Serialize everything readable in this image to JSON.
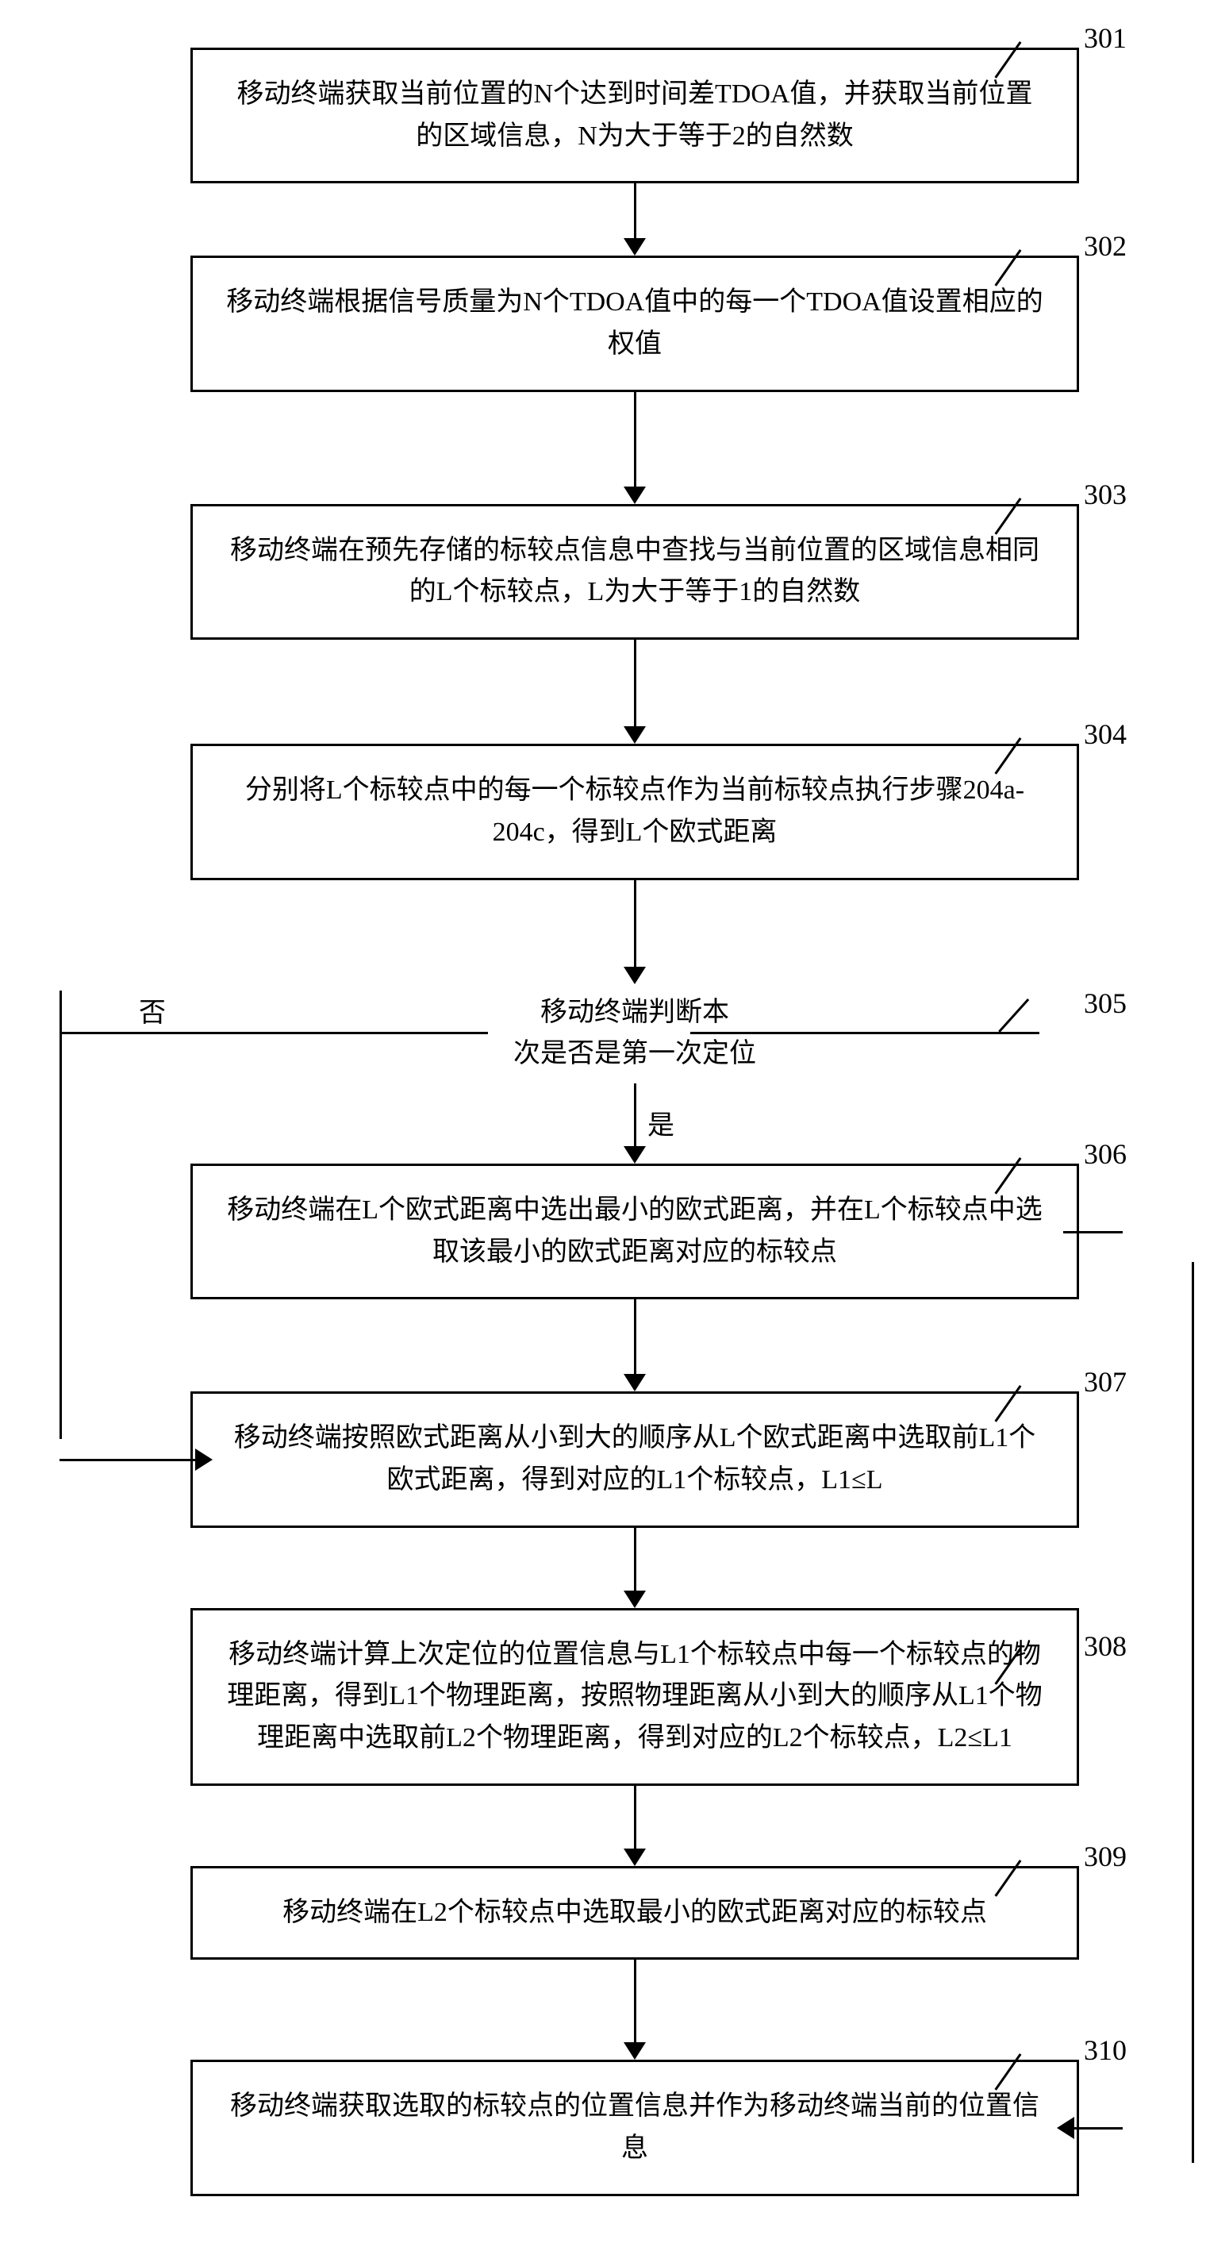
{
  "steps": {
    "s301": {
      "num": "301",
      "text": "移动终端获取当前位置的N个达到时间差TDOA值，并获取当前位置的区域信息，N为大于等于2的自然数"
    },
    "s302": {
      "num": "302",
      "text": "移动终端根据信号质量为N个TDOA值中的每一个TDOA值设置相应的权值"
    },
    "s303": {
      "num": "303",
      "text": "移动终端在预先存储的标较点信息中查找与当前位置的区域信息相同的L个标较点，L为大于等于1的自然数"
    },
    "s304": {
      "num": "304",
      "text": "分别将L个标较点中的每一个标较点作为当前标较点执行步骤204a-204c，得到L个欧式距离"
    },
    "s305": {
      "num": "305",
      "line1": "移动终端判断本",
      "line2": "次是否是第一次定位"
    },
    "s306": {
      "num": "306",
      "text": "移动终端在L个欧式距离中选出最小的欧式距离，并在L个标较点中选取该最小的欧式距离对应的标较点"
    },
    "s307": {
      "num": "307",
      "text": "移动终端按照欧式距离从小到大的顺序从L个欧式距离中选取前L1个欧式距离，得到对应的L1个标较点，L1≤L"
    },
    "s308": {
      "num": "308",
      "text": "移动终端计算上次定位的位置信息与L1个标较点中每一个标较点的物理距离，得到L1个物理距离，按照物理距离从小到大的顺序从L1个物理距离中选取前L2个物理距离，得到对应的L2个标较点，L2≤L1"
    },
    "s309": {
      "num": "309",
      "text": "移动终端在L2个标较点中选取最小的欧式距离对应的标较点"
    },
    "s310": {
      "num": "310",
      "text": "移动终端获取选取的标较点的位置信息并作为移动终端当前的位置信息"
    }
  },
  "labels": {
    "no": "否",
    "yes": "是"
  }
}
